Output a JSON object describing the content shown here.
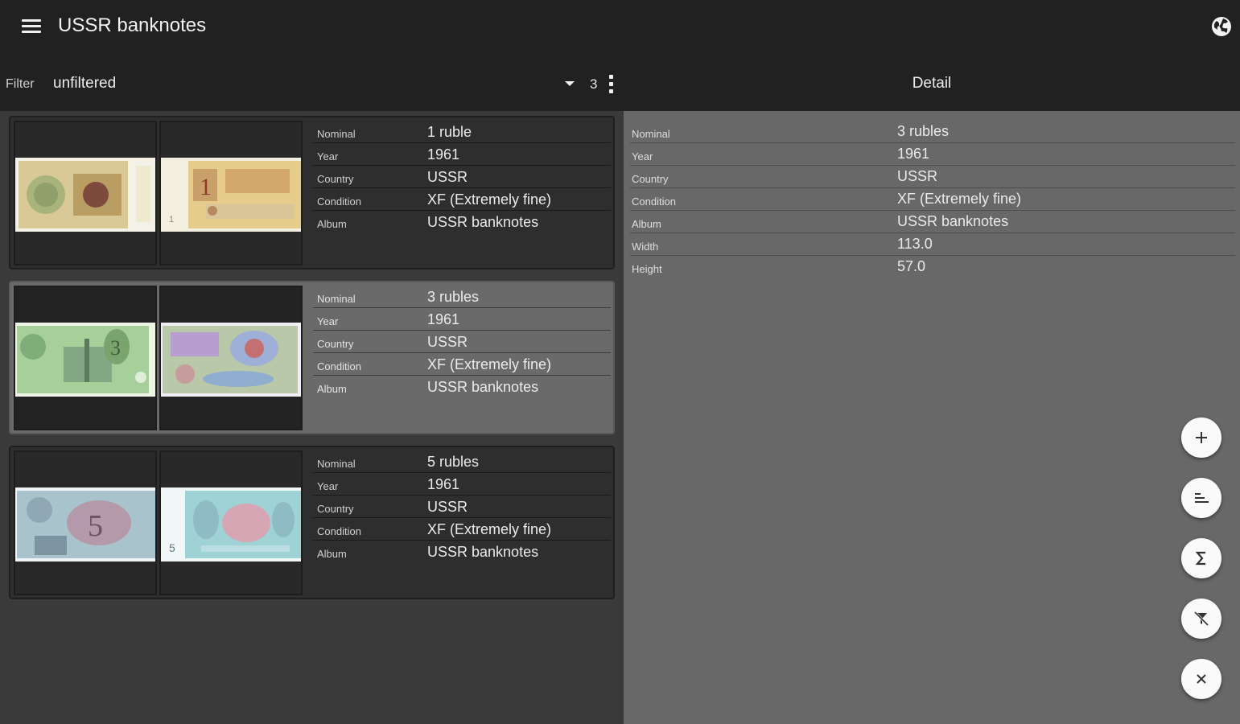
{
  "appbar": {
    "title": "USSR banknotes",
    "menu_icon": "menu-icon",
    "globe_icon": "globe-icon"
  },
  "filter": {
    "label": "Filter",
    "value": "unfiltered",
    "count": "3",
    "dropdown_icon": "dropdown-arrow-icon",
    "overflow_icon": "more-vert-icon"
  },
  "detail_header": {
    "title": "Detail"
  },
  "list": {
    "cards": [
      {
        "selected": false,
        "fields": [
          {
            "key": "Nominal",
            "value": "1 ruble"
          },
          {
            "key": "Year",
            "value": "1961"
          },
          {
            "key": "Country",
            "value": "USSR"
          },
          {
            "key": "Condition",
            "value": "XF (Extremely fine)"
          },
          {
            "key": "Album",
            "value": "USSR banknotes"
          }
        ],
        "colors": {
          "front": "#d8c79a",
          "back": "#e2c98e"
        }
      },
      {
        "selected": true,
        "fields": [
          {
            "key": "Nominal",
            "value": "3 rubles"
          },
          {
            "key": "Year",
            "value": "1961"
          },
          {
            "key": "Country",
            "value": "USSR"
          },
          {
            "key": "Condition",
            "value": "XF (Extremely fine)"
          },
          {
            "key": "Album",
            "value": "USSR banknotes"
          }
        ],
        "colors": {
          "front": "#9fcf9a",
          "back": "#c9a9d8"
        }
      },
      {
        "selected": false,
        "fields": [
          {
            "key": "Nominal",
            "value": "5 rubles"
          },
          {
            "key": "Year",
            "value": "1961"
          },
          {
            "key": "Country",
            "value": "USSR"
          },
          {
            "key": "Condition",
            "value": "XF (Extremely fine)"
          },
          {
            "key": "Album",
            "value": "USSR banknotes"
          }
        ],
        "colors": {
          "front": "#a9c4cf",
          "back": "#9fd3d6"
        }
      }
    ]
  },
  "detail": {
    "rows": [
      {
        "key": "Nominal",
        "value": "3 rubles"
      },
      {
        "key": "Year",
        "value": "1961"
      },
      {
        "key": "Country",
        "value": "USSR"
      },
      {
        "key": "Condition",
        "value": "XF (Extremely fine)"
      },
      {
        "key": "Album",
        "value": "USSR banknotes"
      },
      {
        "key": "Width",
        "value": "113.0"
      },
      {
        "key": "Height",
        "value": "57.0"
      }
    ]
  },
  "fabs": [
    {
      "name": "add-button",
      "icon": "plus-icon"
    },
    {
      "name": "sort-button",
      "icon": "sort-icon"
    },
    {
      "name": "sum-button",
      "icon": "sigma-icon"
    },
    {
      "name": "filter-off-button",
      "icon": "filter-off-icon"
    },
    {
      "name": "close-button",
      "icon": "close-icon"
    }
  ],
  "colors": {
    "appbar": "#212121",
    "list_bg": "#3a3a3a",
    "card": "#2e2e2e",
    "card_selected": "#6a6a6a",
    "detail_bg": "#686868",
    "fab": "#fafafa"
  }
}
